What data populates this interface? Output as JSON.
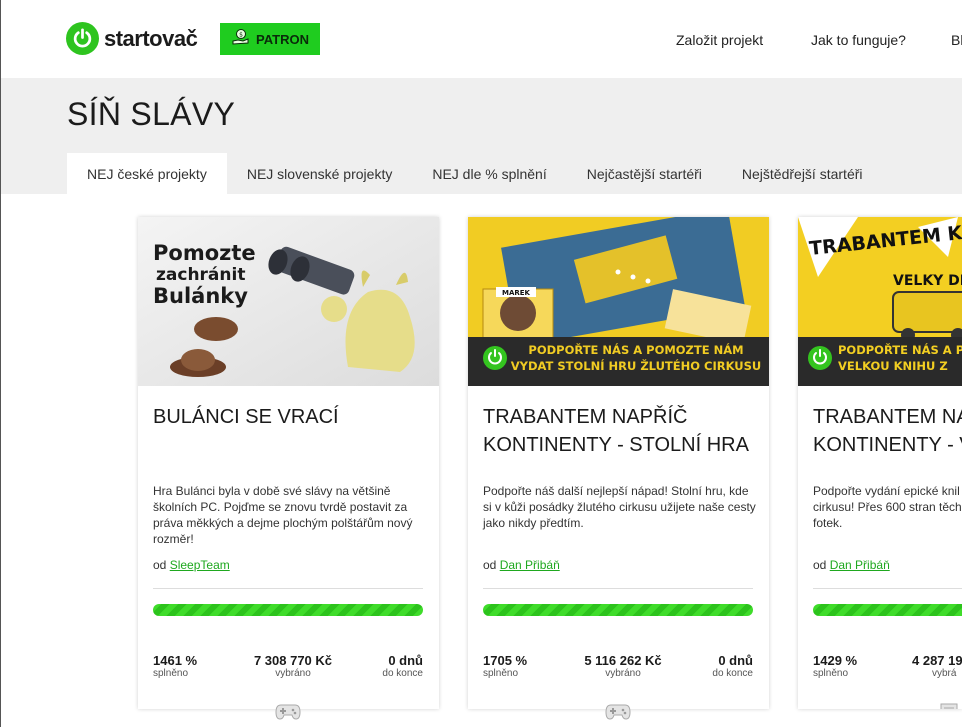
{
  "header": {
    "logo_text": "startovač",
    "patron_label": "PATRON",
    "nav": [
      "Založit projekt",
      "Jak to funguje?",
      "Bl"
    ]
  },
  "page_title": "SÍŇ SLÁVY",
  "tabs": [
    {
      "label": "NEJ české projekty",
      "active": true
    },
    {
      "label": "NEJ slovenské projekty",
      "active": false
    },
    {
      "label": "NEJ dle % splnění",
      "active": false
    },
    {
      "label": "Nejčastější startéři",
      "active": false
    },
    {
      "label": "Nejštědřejší startéři",
      "active": false
    }
  ],
  "cards": [
    {
      "image_text": [
        "Pomozte",
        "zachránit",
        "Bulánky"
      ],
      "title": "BULÁNCI SE VRACÍ",
      "description": "Hra Bulánci byla v době své slávy na většině školních PC. Pojďme se znovu tvrdě postavit za práva měkkých a dejme plochým polštářům nový rozměr!",
      "author_prefix": "od",
      "author": "SleepTeam",
      "percent": "1461 %",
      "percent_label": "splněno",
      "amount": "7 308 770 Kč",
      "amount_label": "vybráno",
      "days": "0 dnů",
      "days_label": "do konce",
      "category_icon": "gamepad-icon",
      "progress_fraction": 1.0
    },
    {
      "image_text": [
        "PODPOŘTE NÁS A POMOZTE NÁM",
        "VYDAT STOLNÍ HRU ŽLUTÉHO CIRKUSU"
      ],
      "image_name_tag": "MAREK",
      "title": "TRABANTEM NAPŘÍČ KONTINENTY - STOLNÍ HRA",
      "description": "Podpořte náš další nejlepší nápad! Stolní hru, kde si v kůži posádky žlutého cirkusu užijete naše cesty jako nikdy předtím.",
      "author_prefix": "od",
      "author": "Dan Přibáň",
      "percent": "1705 %",
      "percent_label": "splněno",
      "amount": "5 116 262 Kč",
      "amount_label": "vybráno",
      "days": "0 dnů",
      "days_label": "do konce",
      "category_icon": "gamepad-icon",
      "progress_fraction": 1.0
    },
    {
      "image_text": [
        "TRABANTEM K",
        "VELKY DE",
        "PODPOŘTE NÁS A PO",
        "VELKOU KNIHU Z"
      ],
      "title": "TRABANTEM NA KONTINENTY - V",
      "description": "Podpořte vydání epické knil cirkusu! Přes 600 stran těch fotek.",
      "author_prefix": "od",
      "author": "Dan Přibáň",
      "percent": "1429 %",
      "percent_label": "splněno",
      "amount": "4 287 19",
      "amount_label": "vybrá",
      "category_icon": "book-icon",
      "progress_fraction": 1.0
    }
  ]
}
